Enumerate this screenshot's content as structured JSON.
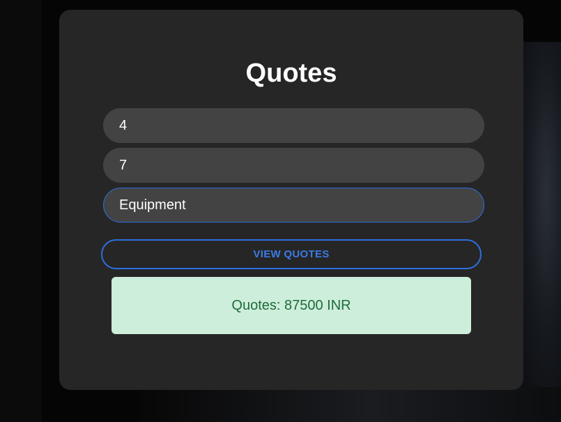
{
  "card": {
    "title": "Quotes"
  },
  "form": {
    "field1_value": "4",
    "field2_value": "7",
    "field3_value": "Equipment",
    "submit_label": "VIEW QUOTES"
  },
  "result": {
    "text": "Quotes: 87500 INR"
  },
  "colors": {
    "accent": "#2d6fe0",
    "card_bg": "#262626",
    "input_bg": "#434343",
    "result_bg": "#cdeeda",
    "result_text": "#1f6b3b"
  }
}
